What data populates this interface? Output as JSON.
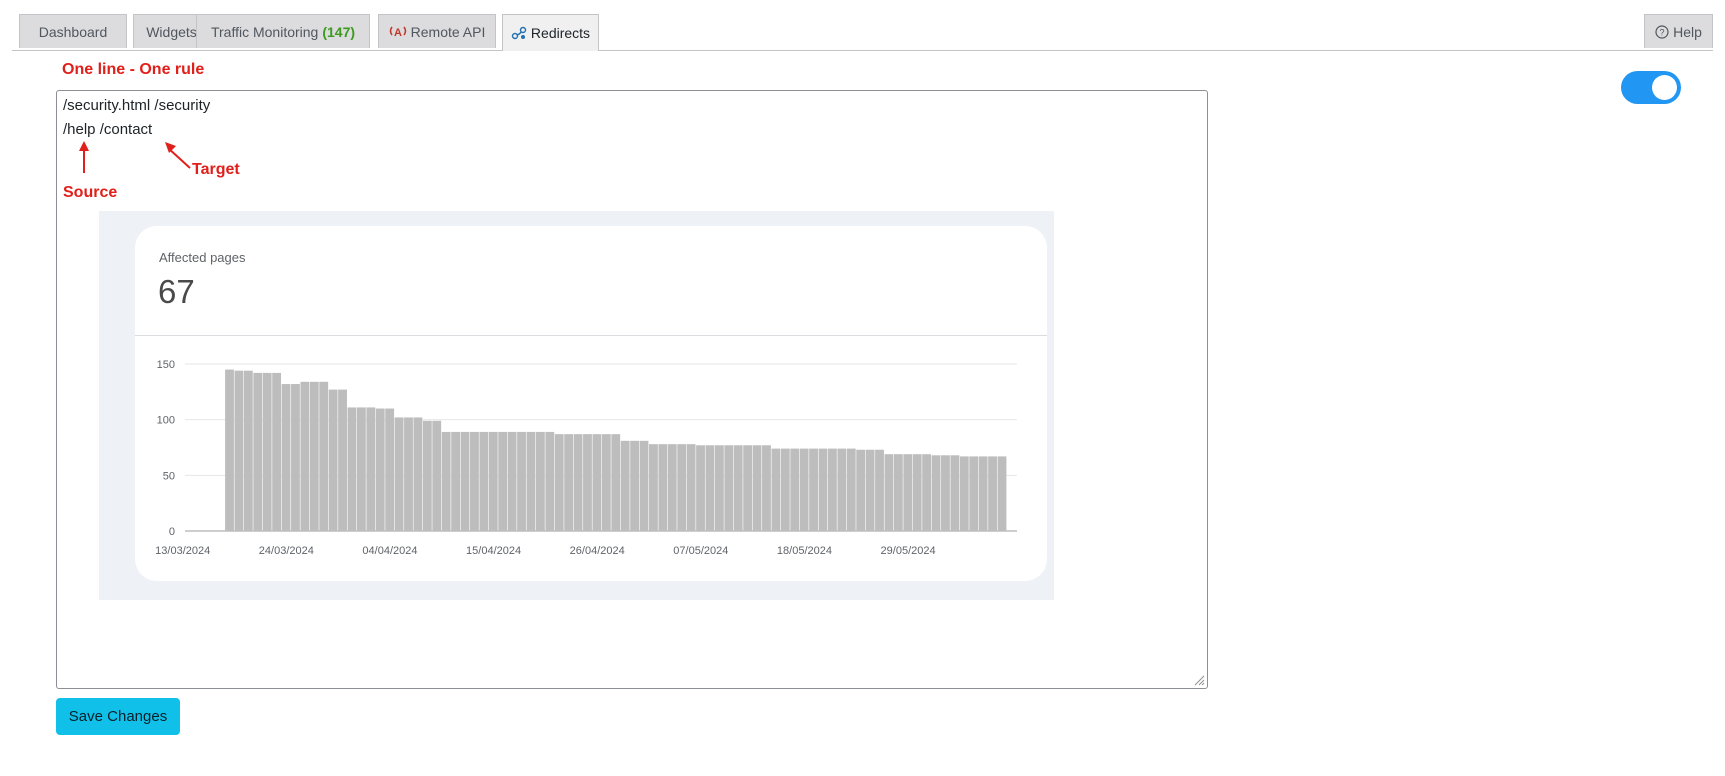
{
  "tabs": [
    {
      "label": "Dashboard"
    },
    {
      "label": "Widgets"
    },
    {
      "label": "Traffic Monitoring",
      "count": "(147)"
    },
    {
      "label": "Remote API",
      "icon": "antenna-icon"
    },
    {
      "label": "Redirects",
      "icon": "redirect-icon",
      "active": true
    }
  ],
  "help": {
    "label": "Help",
    "icon": "question-circle-icon"
  },
  "heading": "One line - One rule",
  "toggle": {
    "state": "on",
    "color": "#2196f3"
  },
  "editor": {
    "lines": [
      "/security.html /security",
      "/help /contact"
    ],
    "annotations": {
      "source": "Source",
      "target": "Target"
    }
  },
  "metric": {
    "label": "Affected pages",
    "value": "67"
  },
  "chart_data": {
    "type": "bar",
    "x_tick_labels": [
      "13/03/2024",
      "24/03/2024",
      "04/04/2024",
      "15/04/2024",
      "26/04/2024",
      "07/05/2024",
      "18/05/2024",
      "29/05/2024"
    ],
    "y_ticks": [
      0,
      50,
      100,
      150
    ],
    "ylim": [
      0,
      150
    ],
    "grid": true,
    "bar_color": "#bdbdbd",
    "values": [
      0,
      0,
      0,
      0,
      0,
      145,
      144,
      144,
      142,
      142,
      142,
      132,
      132,
      134,
      134,
      134,
      127,
      127,
      111,
      111,
      111,
      110,
      110,
      102,
      102,
      102,
      99,
      99,
      89,
      89,
      89,
      89,
      89,
      89,
      89,
      89,
      89,
      89,
      89,
      89,
      87,
      87,
      87,
      87,
      87,
      87,
      87,
      81,
      81,
      81,
      78,
      78,
      78,
      78,
      78,
      77,
      77,
      77,
      77,
      77,
      77,
      77,
      77,
      74,
      74,
      74,
      74,
      74,
      74,
      74,
      74,
      74,
      73,
      73,
      73,
      69,
      69,
      69,
      69,
      69,
      68,
      68,
      68,
      67,
      67,
      67,
      67,
      67
    ]
  },
  "save_button": {
    "label": "Save Changes",
    "color": "#10c0e8"
  },
  "accent_red": "#e0201b"
}
